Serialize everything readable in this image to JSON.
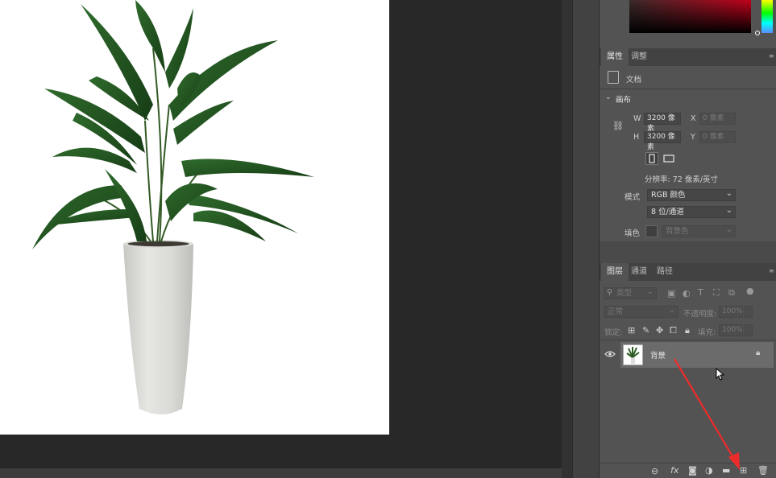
{
  "properties_panel": {
    "tabs": [
      "属性",
      "调整"
    ],
    "doc_type_label": "文档",
    "canvas_section_title": "画布",
    "width_label": "W",
    "width_value": "3200 像素",
    "height_label": "H",
    "height_value": "3200 像素",
    "x_label": "X",
    "x_placeholder": "0 像素",
    "y_label": "Y",
    "y_placeholder": "0 像素",
    "resolution_text": "分辨率: 72 像素/英寸",
    "mode_label": "模式",
    "mode_value": "RGB 颜色",
    "depth_value": "8 位/通道",
    "fill_label": "填色",
    "fill_value": "背景色"
  },
  "layers_panel": {
    "tabs": [
      "图层",
      "通道",
      "路径"
    ],
    "filter_kind": "类型",
    "blend_mode": "正常",
    "opacity_label": "不透明度:",
    "opacity_value": "100%",
    "lock_label": "锁定:",
    "fill_label": "填充:",
    "fill_value": "100%",
    "layers": [
      {
        "name": "背景",
        "visible": true,
        "locked": true
      }
    ],
    "footer_icons": [
      "link-icon",
      "fx-icon",
      "mask-icon",
      "adjustment-icon",
      "folder-icon",
      "new-layer-icon",
      "trash-icon"
    ]
  },
  "colors": {
    "panel_bg": "#535353",
    "tab_bar": "#424242",
    "selected_layer": "#6b6b6b",
    "annotation_arrow": "#ee2b2b"
  }
}
